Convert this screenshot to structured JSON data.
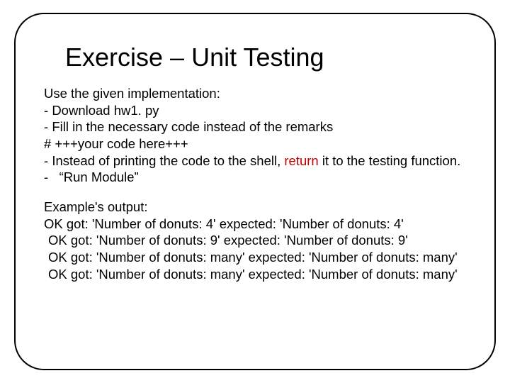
{
  "title": "Exercise – Unit Testing",
  "intro": "Use the given implementation:",
  "steps": {
    "download": "Download hw1. py",
    "fill": "Fill in the necessary code instead of the remarks",
    "marker": "# +++your code here+++",
    "instead_pre": "Instead of printing the code to the shell, ",
    "instead_return": "return",
    "instead_post": " it to the testing function.",
    "run": "“Run Module”"
  },
  "example_label": "Example's output:",
  "output": {
    "l1": "OK  got: 'Number of donuts: 4' expected: 'Number of donuts: 4'",
    "l2": "OK  got: 'Number of donuts: 9' expected: 'Number of donuts: 9'",
    "l3": "OK  got: 'Number of donuts: many' expected: 'Number of donuts: many'",
    "l4": "OK  got: 'Number of donuts: many' expected: 'Number of donuts: many'"
  }
}
